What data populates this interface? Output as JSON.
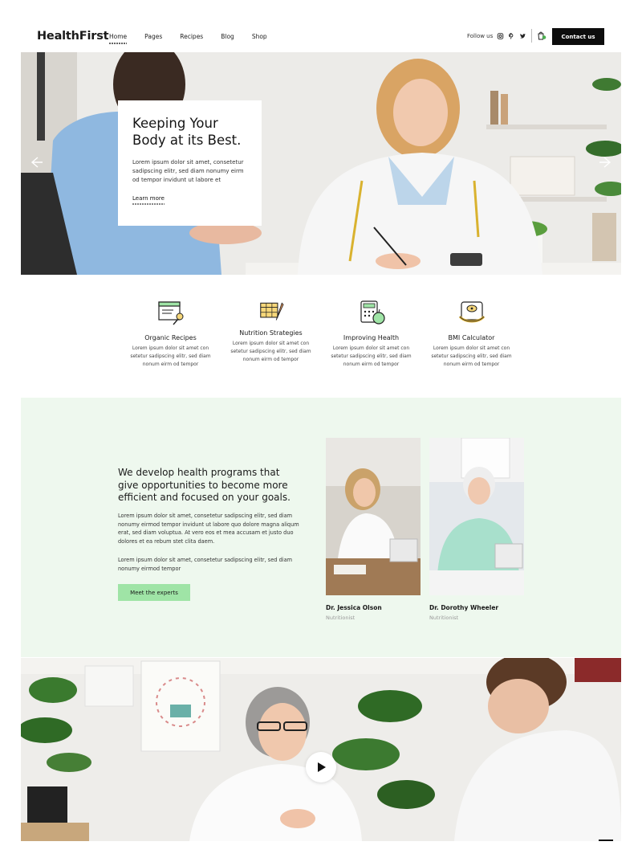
{
  "header": {
    "logo": "HealthFirst",
    "nav": [
      "Home",
      "Pages",
      "Recipes",
      "Blog",
      "Shop"
    ],
    "active_nav": "Home",
    "follow_label": "Follow us",
    "social_icons": [
      "instagram-icon",
      "pinterest-icon",
      "twitter-icon"
    ],
    "contact_label": "Contact us"
  },
  "hero": {
    "title_line1": "Keeping Your",
    "title_line2": "Body at its Best.",
    "text": "Lorem ipsum dolor sit amet, consetetur sadipscing elitr, sed diam nonumy eirm od tempor invidunt ut labore et",
    "link": "Learn more"
  },
  "features": [
    {
      "icon": "recipe-book-icon",
      "title": "Organic Recipes",
      "text": "Lorem ipsum dolor sit amet con setetur sadipscing elitr, sed diam nonum eirm od tempor"
    },
    {
      "icon": "calendar-carrot-icon",
      "title": "Nutrition Strategies",
      "text": "Lorem ipsum dolor sit amet con setetur sadipscing elitr, sed diam nonum eirm od tempor"
    },
    {
      "icon": "calculator-apple-icon",
      "title": "Improving Health",
      "text": "Lorem ipsum dolor sit amet con setetur sadipscing elitr, sed diam nonum eirm od tempor"
    },
    {
      "icon": "scale-tape-icon",
      "title": "BMI Calculator",
      "text": "Lorem ipsum dolor sit amet con setetur sadipscing elitr, sed diam nonum eirm od tempor"
    }
  ],
  "programs": {
    "title": "We develop health programs that give opportunities to become more efficient and focused on your goals.",
    "p1": "Lorem ipsum dolor sit amet, consetetur sadipscing elitr, sed diam nonumy eirmod tempor invidunt ut labore quo dolore magna aliqum erat, sed diam voluptua. At vero eos et mea accusam et justo duo dolores et ea rebum stet clita daem.",
    "p2": "Lorem ipsum dolor sit amet, consetetur sadipscing elitr, sed diam nonumy eirmod tempor",
    "button": "Meet the experts",
    "experts": [
      {
        "name": "Dr. Jessica Olson",
        "role": "Nutritionist"
      },
      {
        "name": "Dr. Dorothy Wheeler",
        "role": "Nutritionist"
      }
    ]
  },
  "colors": {
    "accent_green": "#9fe4a6",
    "section_bg": "#eef8ee",
    "dark": "#0d0d0d"
  }
}
